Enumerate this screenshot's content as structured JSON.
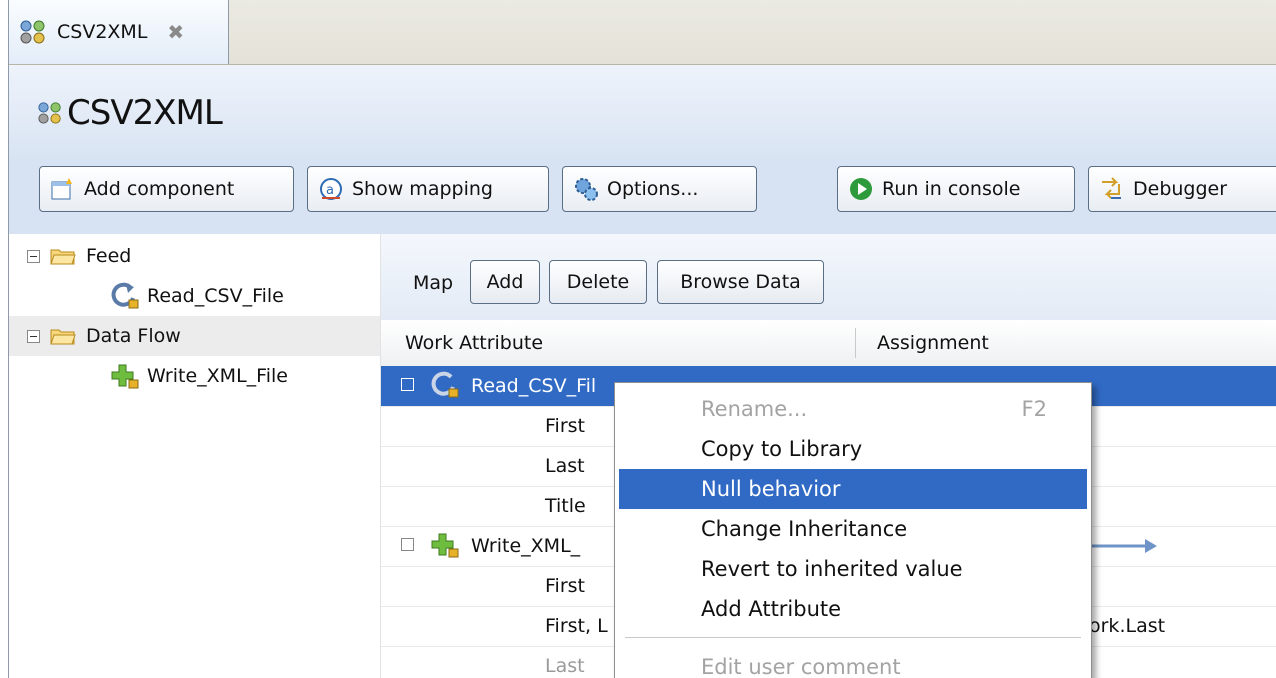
{
  "tab": {
    "label": "CSV2XML",
    "close_glyph": "✖"
  },
  "header": {
    "title": "CSV2XML"
  },
  "toolbar": {
    "add_component": "Add component",
    "show_mapping": "Show mapping",
    "options": "Options...",
    "run_in_console": "Run in console",
    "debugger": "Debugger"
  },
  "tree": {
    "feed": "Feed",
    "read_csv": "Read_CSV_File",
    "data_flow": "Data Flow",
    "write_xml": "Write_XML_File"
  },
  "mapbar": {
    "label": "Map",
    "add": "Add",
    "delete": "Delete",
    "browse": "Browse Data"
  },
  "grid": {
    "col_work": "Work Attribute",
    "col_assign": "Assignment",
    "rows": [
      {
        "name": "Read_CSV_Fil"
      },
      {
        "name": "First"
      },
      {
        "name": "Last"
      },
      {
        "name": "Title"
      },
      {
        "name": "Write_XML_"
      },
      {
        "name": "First"
      },
      {
        "name": "First, L",
        "assign": "ork.Last"
      },
      {
        "name": "Last"
      }
    ]
  },
  "context_menu": {
    "items": [
      {
        "label": "Rename...",
        "shortcut": "F2"
      },
      {
        "label": "Copy to Library"
      },
      {
        "label": "Null behavior"
      },
      {
        "label": "Change Inheritance"
      },
      {
        "label": "Revert to inherited value"
      },
      {
        "label": "Add Attribute"
      },
      {
        "label": "Edit user comment"
      }
    ]
  },
  "colors": {
    "selection": "#316ac5",
    "toolbar_bg": "#d7e2f2"
  },
  "icons": [
    "flow-icon",
    "close-icon",
    "add-component-icon",
    "mapping-icon",
    "options-icon",
    "run-icon",
    "debugger-icon",
    "folder-icon",
    "collapse-icon",
    "reader-icon",
    "writer-icon"
  ]
}
